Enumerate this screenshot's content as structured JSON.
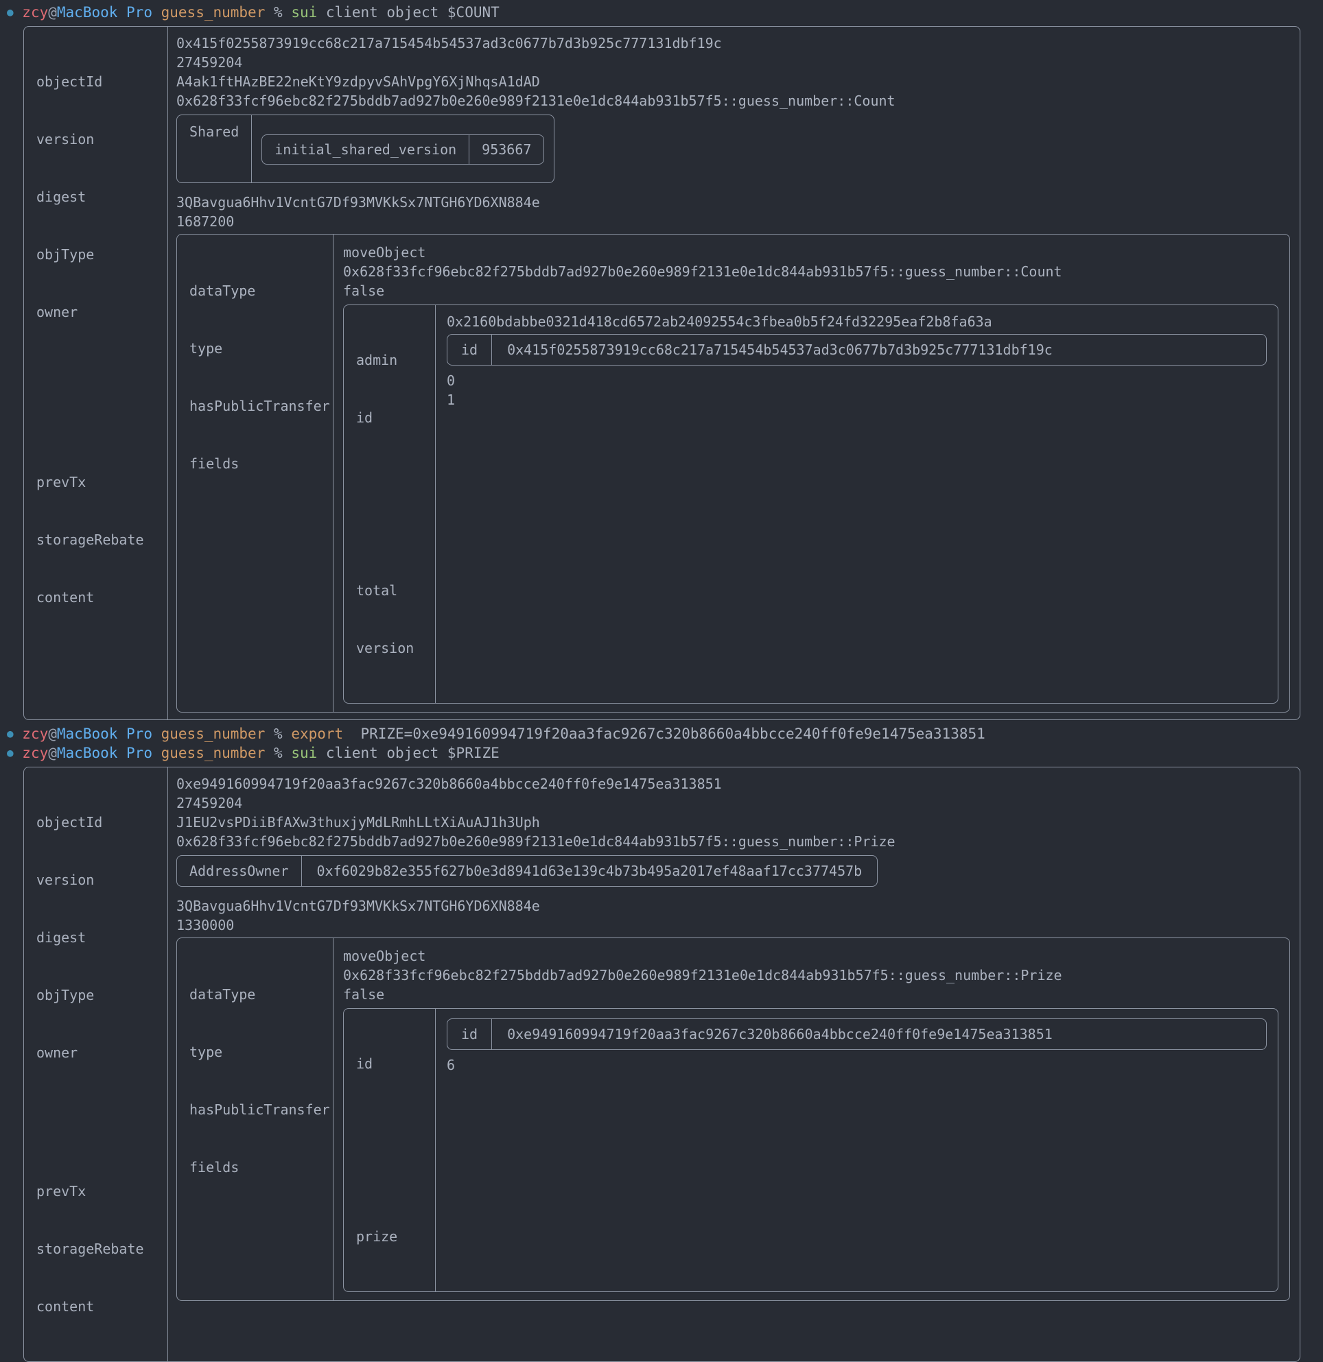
{
  "prompt": {
    "user": "zcy",
    "at": "@",
    "host": "MacBook Pro",
    "dir": "guess_number",
    "pct": "%"
  },
  "commands": {
    "cmd1_name": "sui",
    "cmd1_args": "client object $COUNT",
    "cmd2_name": "export",
    "cmd2_args": "PRIZE=0xe949160994719f20aa3fac9267c320b8660a4bbcce240ff0fe9e1475ea313851",
    "cmd3_name": "sui",
    "cmd3_args": "client object $PRIZE"
  },
  "labels": {
    "objectId": "objectId",
    "version": "version",
    "digest": "digest",
    "objType": "objType",
    "owner": "owner",
    "prevTx": "prevTx",
    "storageRebate": "storageRebate",
    "content": "content",
    "dataType": "dataType",
    "type": "type",
    "hasPublicTransfer": "hasPublicTransfer",
    "fields": "fields",
    "shared": "Shared",
    "initial_shared_version": "initial_shared_version",
    "addressOwner": "AddressOwner",
    "admin": "admin",
    "id": "id",
    "total": "total",
    "prize": "prize"
  },
  "count_object": {
    "objectId": "0x415f0255873919cc68c217a715454b54537ad3c0677b7d3b925c777131dbf19c",
    "version": "27459204",
    "digest": "A4ak1ftHAzBE22neKtY9zdpyvSAhVpgY6XjNhqsA1dAD",
    "objType": "0x628f33fcf96ebc82f275bddb7ad927b0e260e989f2131e0e1dc844ab931b57f5::guess_number::Count",
    "owner_kind": "Shared",
    "initial_shared_version": "953667",
    "prevTx": "3QBavgua6Hhv1VcntG7Df93MVKkSx7NTGH6YD6XN884e",
    "storageRebate": "1687200",
    "content": {
      "dataType": "moveObject",
      "type": "0x628f33fcf96ebc82f275bddb7ad927b0e260e989f2131e0e1dc844ab931b57f5::guess_number::Count",
      "hasPublicTransfer": "false",
      "fields": {
        "admin": "0x2160bdabbe0321d418cd6572ab24092554c3fbea0b5f24fd32295eaf2b8fa63a",
        "id_inner": "0x415f0255873919cc68c217a715454b54537ad3c0677b7d3b925c777131dbf19c",
        "total": "0",
        "version": "1"
      }
    }
  },
  "prize_object": {
    "objectId": "0xe949160994719f20aa3fac9267c320b8660a4bbcce240ff0fe9e1475ea313851",
    "version": "27459204",
    "digest": "J1EU2vsPDiiBfAXw3thuxjyMdLRmhLLtXiAuAJ1h3Uph",
    "objType": "0x628f33fcf96ebc82f275bddb7ad927b0e260e989f2131e0e1dc844ab931b57f5::guess_number::Prize",
    "owner_kind": "AddressOwner",
    "owner_address": "0xf6029b82e355f627b0e3d8941d63e139c4b73b495a2017ef48aaf17cc377457b",
    "prevTx": "3QBavgua6Hhv1VcntG7Df93MVKkSx7NTGH6YD6XN884e",
    "storageRebate": "1330000",
    "content": {
      "dataType": "moveObject",
      "type": "0x628f33fcf96ebc82f275bddb7ad927b0e260e989f2131e0e1dc844ab931b57f5::guess_number::Prize",
      "hasPublicTransfer": "false",
      "fields": {
        "id_inner": "0xe949160994719f20aa3fac9267c320b8660a4bbcce240ff0fe9e1475ea313851",
        "prize": "6"
      }
    }
  },
  "colors": {
    "background": "#282c34",
    "text": "#abb2bf",
    "user": "#e06c75",
    "host": "#61afef",
    "dir": "#d19a66",
    "command": "#98c379",
    "border": "#8b93a1",
    "dot": "#3d8fb5"
  }
}
